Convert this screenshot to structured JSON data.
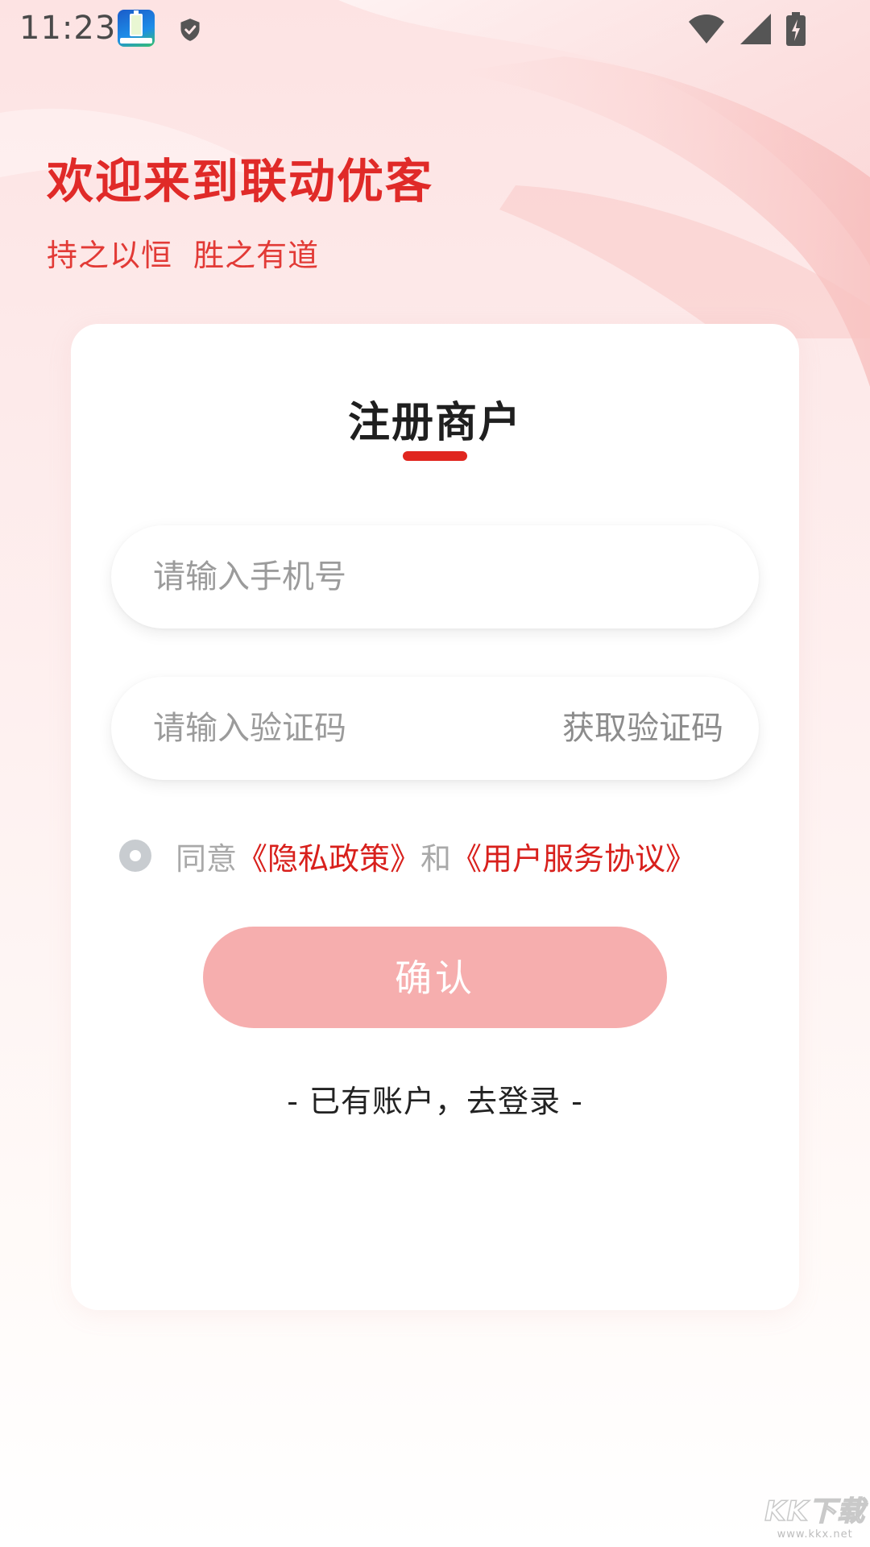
{
  "status_bar": {
    "time": "11:23",
    "icons": [
      "app-notification-icon",
      "shield-icon",
      "wifi-icon",
      "signal-icon",
      "battery-charging-icon"
    ]
  },
  "header": {
    "title": "欢迎来到联动优客",
    "subtitle": "持之以恒  胜之有道"
  },
  "form": {
    "title": "注册商户",
    "phone_placeholder": "请输入手机号",
    "code_placeholder": "请输入验证码",
    "get_code_label": "获取验证码",
    "agree_prefix": "同意",
    "privacy_link": "《隐私政策》",
    "agree_and": "和",
    "service_link": "《用户服务协议》",
    "agree_checked": false,
    "confirm_label": "确认",
    "login_link": "- 已有账户，去登录 -"
  },
  "watermark": {
    "logo": "KK下载",
    "url": "www.kkx.net"
  },
  "colors": {
    "brand_red": "#e02a28",
    "button_disabled": "#f6aeae",
    "link_red": "#d8201c",
    "placeholder_gray": "#9b9b9b"
  }
}
